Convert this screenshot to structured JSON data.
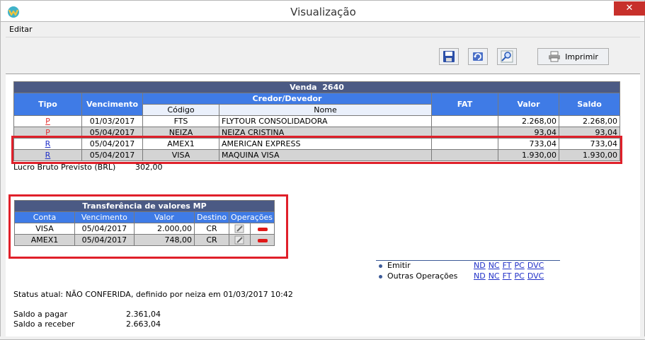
{
  "window": {
    "title": "Visualização",
    "close_label": "✕"
  },
  "menu": {
    "items": [
      {
        "label": "Editar"
      }
    ]
  },
  "toolbar": {
    "print_label": "Imprimir"
  },
  "venda": {
    "title": "Venda  2640",
    "headers": {
      "tipo": "Tipo",
      "vencimento": "Vencimento",
      "credor": "Credor/Devedor",
      "codigo": "Código",
      "nome": "Nome",
      "fat": "FAT",
      "valor": "Valor",
      "saldo": "Saldo"
    },
    "rows": [
      {
        "tipo": "P",
        "vencimento": "01/03/2017",
        "codigo": "FTS",
        "nome": "FLYTOUR CONSOLIDADORA",
        "fat": "",
        "valor": "2.268,00",
        "saldo": "2.268,00"
      },
      {
        "tipo": "P",
        "vencimento": "05/04/2017",
        "codigo": "NEIZA",
        "nome": "NEIZA CRISTINA",
        "fat": "",
        "valor": "93,04",
        "saldo": "93,04"
      },
      {
        "tipo": "R",
        "vencimento": "05/04/2017",
        "codigo": "AMEX1",
        "nome": "AMERICAN EXPRESS",
        "fat": "",
        "valor": "733,04",
        "saldo": "733,04"
      },
      {
        "tipo": "R",
        "vencimento": "05/04/2017",
        "codigo": "VISA",
        "nome": "MAQUINA VISA",
        "fat": "",
        "valor": "1.930,00",
        "saldo": "1.930,00"
      }
    ]
  },
  "lucro": {
    "label": "Lucro Bruto Previsto (BRL)",
    "value": "302,00"
  },
  "transferencia": {
    "title": "Transferência de valores MP",
    "headers": {
      "conta": "Conta",
      "vencimento": "Vencimento",
      "valor": "Valor",
      "destino": "Destino",
      "operacoes": "Operações"
    },
    "rows": [
      {
        "conta": "VISA",
        "vencimento": "05/04/2017",
        "valor": "2.000,00",
        "destino": "CR"
      },
      {
        "conta": "AMEX1",
        "vencimento": "05/04/2017",
        "valor": "748,00",
        "destino": "CR"
      }
    ]
  },
  "operacoes": {
    "emitir": {
      "label": "Emitir",
      "links": [
        "ND",
        "NC",
        "FT",
        "PC",
        "DVC"
      ]
    },
    "outras": {
      "label": "Outras Operações",
      "links": [
        "ND",
        "NC",
        "FT",
        "PC",
        "DVC"
      ]
    }
  },
  "status": {
    "text": "Status atual: NÃO CONFERIDA, definido por neiza em 01/03/2017 10:42"
  },
  "saldos": {
    "pagar": {
      "label": "Saldo a pagar",
      "value": "2.361,04"
    },
    "receber": {
      "label": "Saldo a receber",
      "value": "2.663,04"
    }
  },
  "colors": {
    "header_dark": "#4b5a84",
    "header_blue": "#3f7be6",
    "highlight": "#e0202a"
  }
}
